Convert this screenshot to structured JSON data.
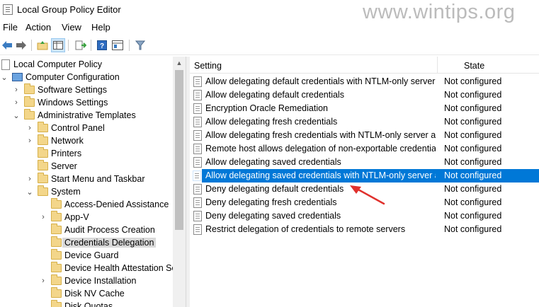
{
  "window": {
    "title": "Local Group Policy Editor",
    "watermark": "www.wintips.org"
  },
  "menubar": {
    "items": [
      "File",
      "Action",
      "View",
      "Help"
    ]
  },
  "toolbar": {
    "buttons": [
      "back-icon",
      "forward-icon",
      "up-folder-icon",
      "show-hide-tree-icon",
      "export-list-icon",
      "help-icon",
      "properties-view-icon",
      "filter-icon"
    ]
  },
  "tree": {
    "root": "Local Computer Policy",
    "computer_config": "Computer Configuration",
    "software_settings": "Software Settings",
    "windows_settings": "Windows Settings",
    "admin_templates": "Administrative Templates",
    "control_panel": "Control Panel",
    "network": "Network",
    "printers": "Printers",
    "server": "Server",
    "start_menu": "Start Menu and Taskbar",
    "system": "System",
    "access_denied": "Access-Denied Assistance",
    "app_v": "App-V",
    "audit_process": "Audit Process Creation",
    "credentials_delegation": "Credentials Delegation",
    "device_guard": "Device Guard",
    "device_health": "Device Health Attestation Se",
    "device_installation": "Device Installation",
    "disk_nv_cache": "Disk NV Cache",
    "disk_quotas": "Disk Quotas"
  },
  "list": {
    "columns": {
      "setting": "Setting",
      "state": "State"
    },
    "selected_index": 7,
    "rows": [
      {
        "setting": "Allow delegating default credentials with NTLM-only server ...",
        "state": "Not configured"
      },
      {
        "setting": "Allow delegating default credentials",
        "state": "Not configured"
      },
      {
        "setting": "Encryption Oracle Remediation",
        "state": "Not configured"
      },
      {
        "setting": "Allow delegating fresh credentials",
        "state": "Not configured"
      },
      {
        "setting": "Allow delegating fresh credentials with NTLM-only server au...",
        "state": "Not configured"
      },
      {
        "setting": "Remote host allows delegation of non-exportable credentials",
        "state": "Not configured"
      },
      {
        "setting": "Allow delegating saved credentials",
        "state": "Not configured"
      },
      {
        "setting": "Allow delegating saved credentials with NTLM-only server a...",
        "state": "Not configured"
      },
      {
        "setting": "Deny delegating default credentials",
        "state": "Not configured"
      },
      {
        "setting": "Deny delegating fresh credentials",
        "state": "Not configured"
      },
      {
        "setting": "Deny delegating saved credentials",
        "state": "Not configured"
      },
      {
        "setting": "Restrict delegation of credentials to remote servers",
        "state": "Not configured"
      }
    ]
  },
  "colors": {
    "selection": "#0078d7",
    "annotation_arrow": "#e0312d",
    "tree_selection": "#d9d9d9"
  }
}
